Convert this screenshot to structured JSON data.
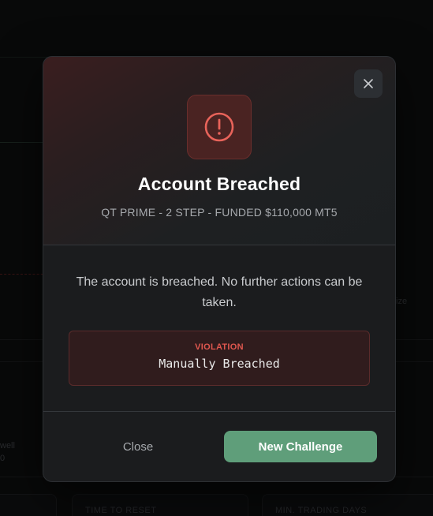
{
  "modal": {
    "title": "Account Breached",
    "subtitle": "QT PRIME - 2 STEP - FUNDED $110,000 MT5",
    "message": "The account is breached. No further actions can be taken.",
    "violation": {
      "label": "VIOLATION",
      "value": "Manually Breached"
    },
    "close_label": "Close",
    "primary_label": "New Challenge",
    "icon": "alert-circle-icon",
    "close_icon": "close-icon"
  },
  "background": {
    "cards": [
      "TIME TO RESET",
      "MIN. TRADING DAYS"
    ],
    "fragments": [
      "ize",
      "well",
      "0"
    ]
  },
  "colors": {
    "accent_green": "#5f9e7a",
    "danger": "#e0574f",
    "modal_bg": "#1b1c1e"
  }
}
